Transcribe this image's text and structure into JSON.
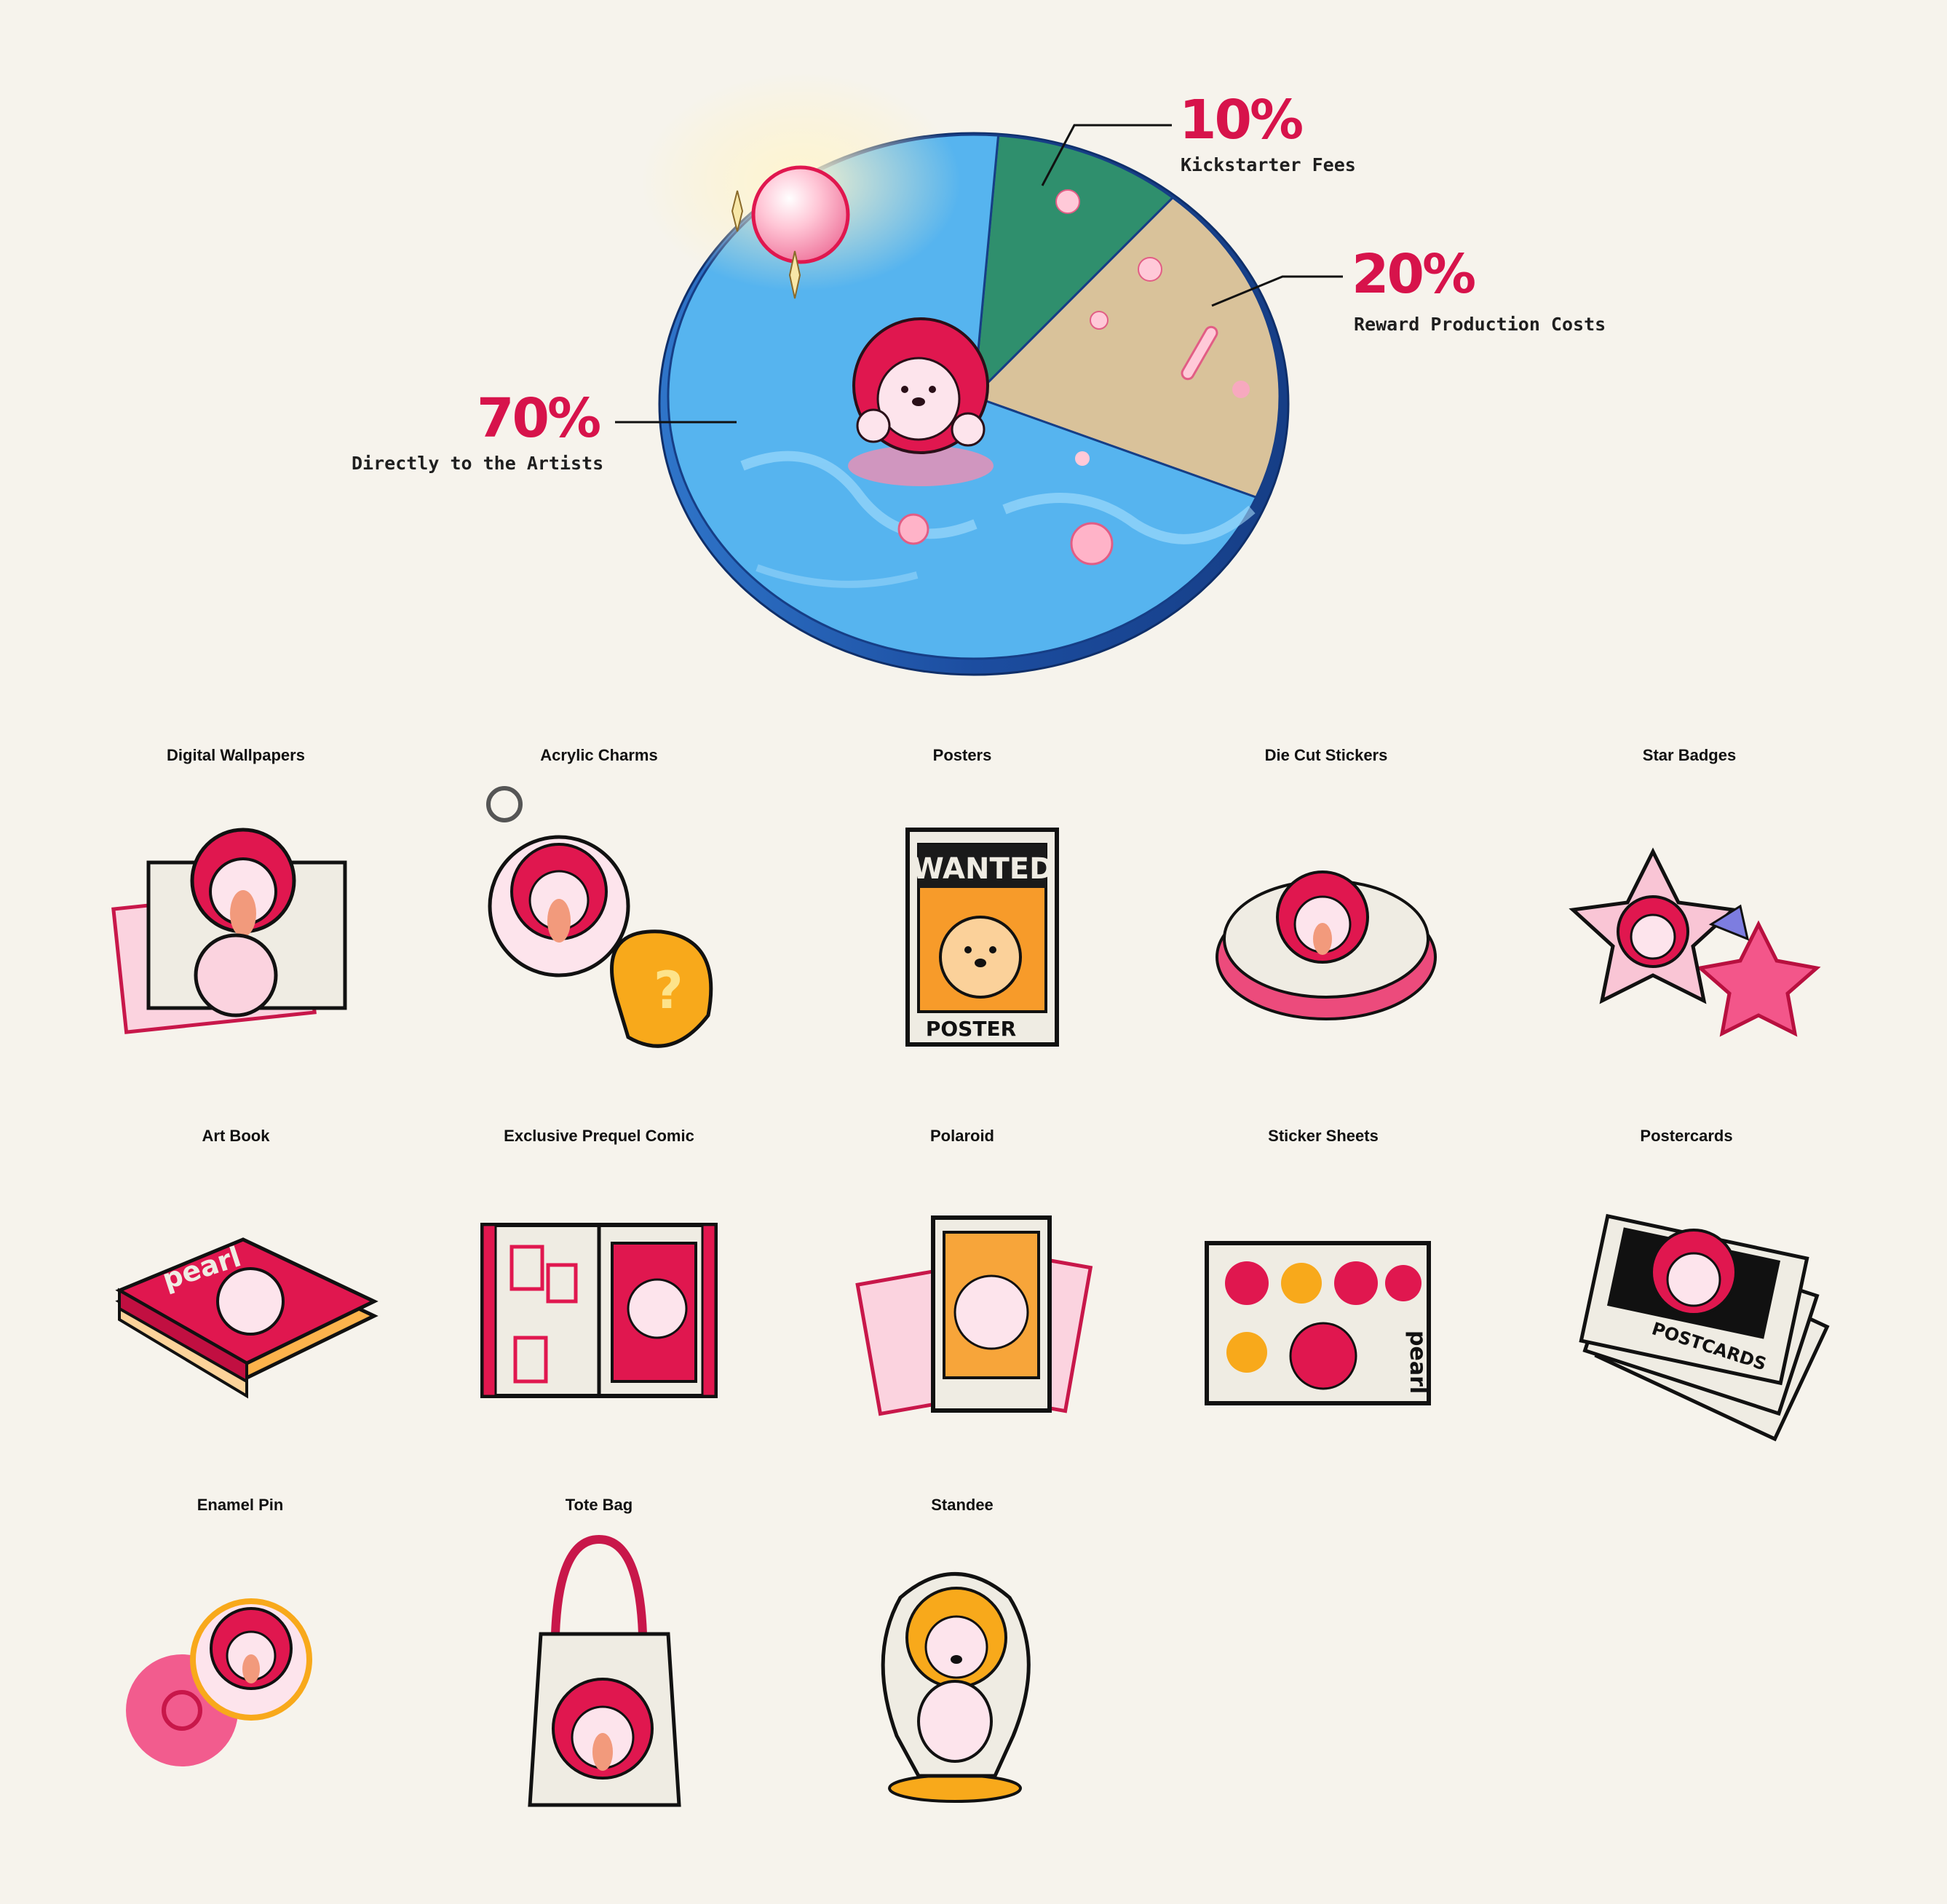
{
  "chart_data": {
    "type": "pie",
    "series": [
      {
        "label": "Directly to the Artists",
        "value": 70,
        "value_label": "70%",
        "color": "#56b4ef"
      },
      {
        "label": "Kickstarter Fees",
        "value": 10,
        "value_label": "10%",
        "color": "#2f8f6d"
      },
      {
        "label": "Reward Production Costs",
        "value": 20,
        "value_label": "20%",
        "color": "#d9c29a"
      }
    ]
  },
  "rewards": [
    {
      "title": "Digital Wallpapers",
      "icon": "wallpaper-icon"
    },
    {
      "title": "Acrylic Charms",
      "icon": "charm-icon"
    },
    {
      "title": "Posters",
      "icon": "poster-icon",
      "art_text": "WANTED",
      "art_sub": "POSTER"
    },
    {
      "title": "Die Cut Stickers",
      "icon": "sticker-icon"
    },
    {
      "title": "Star Badges",
      "icon": "star-badge-icon"
    },
    {
      "title": "Art Book",
      "icon": "art-book-icon",
      "art_text": "pearl"
    },
    {
      "title": "Exclusive Prequel Comic",
      "icon": "comic-icon"
    },
    {
      "title": "Polaroid",
      "icon": "polaroid-icon"
    },
    {
      "title": "Sticker Sheets",
      "icon": "sticker-sheet-icon",
      "art_text": "pearl"
    },
    {
      "title": "Postercards",
      "icon": "postcard-icon",
      "art_text": "POSTCARDS"
    },
    {
      "title": "Enamel Pin",
      "icon": "enamel-pin-icon"
    },
    {
      "title": "Tote Bag",
      "icon": "tote-bag-icon"
    },
    {
      "title": "Standee",
      "icon": "standee-icon"
    }
  ],
  "colors": {
    "background": "#f6f3ec",
    "accent": "#d7134b",
    "mascot": "#e0174f",
    "water": "#56b4ef",
    "grass": "#2f8f6d",
    "sand": "#d9c29a"
  }
}
